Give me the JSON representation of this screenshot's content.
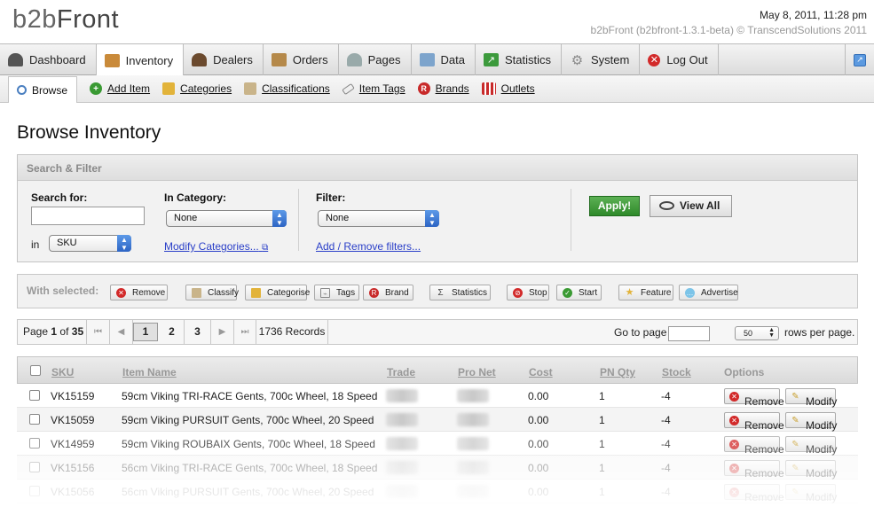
{
  "header": {
    "logo_prefix": "b2b",
    "logo_suffix": "Front",
    "datetime": "May 8, 2011, 11:28 pm",
    "version": "b2bFront (b2bfront-1.3.1-beta) © TranscendSolutions 2011"
  },
  "main_nav": [
    {
      "label": "Dashboard",
      "icon": "dashboard-icon",
      "active": false
    },
    {
      "label": "Inventory",
      "icon": "inventory-box-icon",
      "active": true
    },
    {
      "label": "Dealers",
      "icon": "person-icon",
      "active": false
    },
    {
      "label": "Orders",
      "icon": "orders-icon",
      "active": false
    },
    {
      "label": "Pages",
      "icon": "pages-people-icon",
      "active": false
    },
    {
      "label": "Data",
      "icon": "data-table-icon",
      "active": false
    },
    {
      "label": "Statistics",
      "icon": "chart-icon",
      "active": false
    },
    {
      "label": "System",
      "icon": "gear-icon",
      "active": false
    },
    {
      "label": "Log Out",
      "icon": "logout-x-icon",
      "active": false
    }
  ],
  "sub_nav": [
    {
      "label": "Browse",
      "icon": "magnifier-icon",
      "active": true
    },
    {
      "label": "Add Item",
      "icon": "add-plus-icon",
      "active": false
    },
    {
      "label": "Categories",
      "icon": "book-icon",
      "active": false
    },
    {
      "label": "Classifications",
      "icon": "folders-icon",
      "active": false
    },
    {
      "label": "Item Tags",
      "icon": "tag-icon",
      "active": false
    },
    {
      "label": "Brands",
      "icon": "registered-icon",
      "active": false
    },
    {
      "label": "Outlets",
      "icon": "shop-icon",
      "active": false
    }
  ],
  "page_title": "Browse Inventory",
  "search_filter": {
    "heading": "Search & Filter",
    "search_label": "Search for:",
    "search_value": "",
    "in_label": "in",
    "in_value": "SKU",
    "category_label": "In Category:",
    "category_value": "None",
    "modify_categories": "Modify Categories...",
    "filter_label": "Filter:",
    "filter_value": "None",
    "add_remove_filters": "Add / Remove filters...",
    "apply": "Apply!",
    "view_all": "View All"
  },
  "with_selected": {
    "label": "With selected:",
    "buttons": [
      "Remove",
      "Classify",
      "Categorise",
      "Tags",
      "Brand",
      "Statistics",
      "Stop",
      "Start",
      "Feature",
      "Advertise"
    ]
  },
  "pagination": {
    "page_word": "Page",
    "current": "1",
    "of_word": "of",
    "total": "35",
    "pages": [
      "1",
      "2",
      "3"
    ],
    "records": "1736 Records",
    "goto_label": "Go to page",
    "goto_value": "",
    "rows_value": "50",
    "rows_label": "rows per page."
  },
  "table": {
    "headers": [
      "SKU",
      "Item Name",
      "Trade",
      "Pro Net",
      "Cost",
      "PN Qty",
      "Stock",
      "Options"
    ],
    "rows": [
      {
        "sku": "VK15159",
        "name": "59cm Viking TRI-RACE Gents, 700c Wheel, 18 Speed",
        "cost": "0.00",
        "pnqty": "1",
        "stock": "-4"
      },
      {
        "sku": "VK15059",
        "name": "59cm Viking PURSUIT Gents, 700c Wheel, 20 Speed",
        "cost": "0.00",
        "pnqty": "1",
        "stock": "-4"
      },
      {
        "sku": "VK14959",
        "name": "59cm Viking ROUBAIX Gents, 700c Wheel, 18 Speed",
        "cost": "0.00",
        "pnqty": "1",
        "stock": "-4"
      },
      {
        "sku": "VK15156",
        "name": "56cm Viking TRI-RACE Gents, 700c Wheel, 18 Speed",
        "cost": "0.00",
        "pnqty": "1",
        "stock": "-4"
      },
      {
        "sku": "VK15056",
        "name": "56cm Viking PURSUIT Gents, 700c Wheel, 20 Speed",
        "cost": "0.00",
        "pnqty": "1",
        "stock": "-4"
      }
    ],
    "remove_label": "Remove",
    "modify_label": "Modify"
  },
  "colors": {
    "link": "#2a3fc8",
    "apply_green": "#3a9a33",
    "remove_red": "#d22a2a",
    "header_gray": "#999999"
  }
}
